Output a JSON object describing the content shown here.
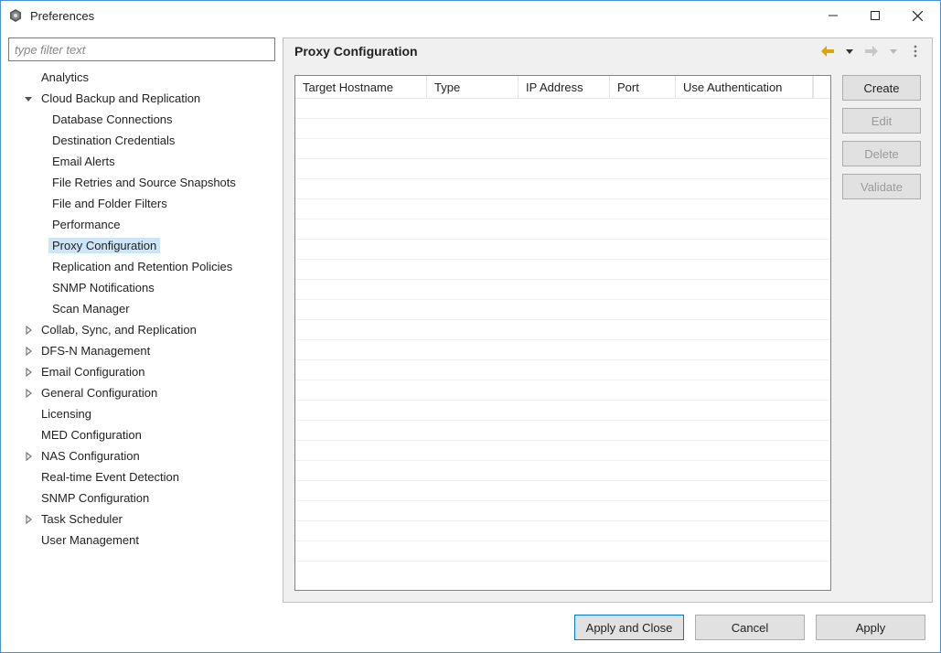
{
  "window": {
    "title": "Preferences"
  },
  "filter": {
    "placeholder": "type filter text"
  },
  "tree": {
    "items": [
      {
        "label": "Analytics",
        "level": 1,
        "expandable": false
      },
      {
        "label": "Cloud Backup and Replication",
        "level": 1,
        "expandable": true,
        "expanded": true
      },
      {
        "label": "Database Connections",
        "level": 2
      },
      {
        "label": "Destination Credentials",
        "level": 2
      },
      {
        "label": "Email Alerts",
        "level": 2
      },
      {
        "label": "File Retries and Source Snapshots",
        "level": 2
      },
      {
        "label": "File and Folder Filters",
        "level": 2
      },
      {
        "label": "Performance",
        "level": 2
      },
      {
        "label": "Proxy Configuration",
        "level": 2,
        "selected": true
      },
      {
        "label": "Replication and Retention Policies",
        "level": 2
      },
      {
        "label": "SNMP Notifications",
        "level": 2
      },
      {
        "label": "Scan Manager",
        "level": 2
      },
      {
        "label": "Collab, Sync, and Replication",
        "level": 1,
        "expandable": true,
        "expanded": false
      },
      {
        "label": "DFS-N Management",
        "level": 1,
        "expandable": true,
        "expanded": false
      },
      {
        "label": "Email Configuration",
        "level": 1,
        "expandable": true,
        "expanded": false
      },
      {
        "label": "General Configuration",
        "level": 1,
        "expandable": true,
        "expanded": false
      },
      {
        "label": "Licensing",
        "level": 1,
        "expandable": false
      },
      {
        "label": "MED Configuration",
        "level": 1,
        "expandable": false
      },
      {
        "label": "NAS Configuration",
        "level": 1,
        "expandable": true,
        "expanded": false
      },
      {
        "label": "Real-time Event Detection",
        "level": 1,
        "expandable": false
      },
      {
        "label": "SNMP Configuration",
        "level": 1,
        "expandable": false
      },
      {
        "label": "Task Scheduler",
        "level": 1,
        "expandable": true,
        "expanded": false
      },
      {
        "label": "User Management",
        "level": 1,
        "expandable": false
      }
    ]
  },
  "page": {
    "title": "Proxy Configuration",
    "columns": {
      "host": "Target Hostname",
      "type": "Type",
      "ip": "IP Address",
      "port": "Port",
      "auth": "Use Authentication"
    },
    "rows": [],
    "emptyRowCount": 23
  },
  "sideButtons": {
    "create": "Create",
    "edit": "Edit",
    "delete": "Delete",
    "validate": "Validate"
  },
  "footer": {
    "applyClose": "Apply and Close",
    "cancel": "Cancel",
    "apply": "Apply"
  }
}
